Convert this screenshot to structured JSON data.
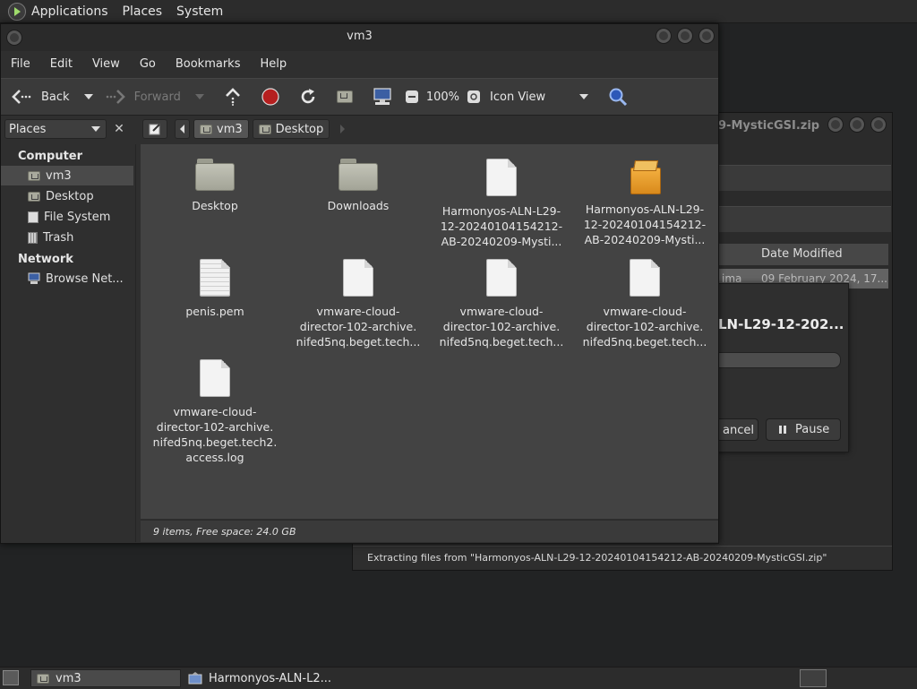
{
  "top_panel": {
    "applications": "Applications",
    "places": "Places",
    "system": "System"
  },
  "background_window": {
    "title": "9-MysticGSI.zip",
    "column_date": "Date Modified",
    "row_name_fragment": "ima",
    "row_date": "09 February 2024, 17...",
    "status": "Extracting files from \"Harmonyos-ALN-L29-12-20240104154212-AB-20240209-MysticGSI.zip\""
  },
  "progress_dialog": {
    "filename": "LN-L29-12-202...",
    "cancel": "ancel",
    "pause": "Pause"
  },
  "file_manager": {
    "title": "vm3",
    "menu": [
      "File",
      "Edit",
      "View",
      "Go",
      "Bookmarks",
      "Help"
    ],
    "toolbar": {
      "back": "Back",
      "forward": "Forward",
      "zoom": "100%",
      "view_mode": "Icon View"
    },
    "sidebar": {
      "selector": "Places",
      "computer_heading": "Computer",
      "network_heading": "Network",
      "items": [
        "vm3",
        "Desktop",
        "File System",
        "Trash"
      ],
      "network_items": [
        "Browse Net..."
      ]
    },
    "path": [
      "vm3",
      "Desktop"
    ],
    "files": [
      {
        "type": "folder",
        "lines": [
          "Desktop"
        ]
      },
      {
        "type": "folder",
        "lines": [
          "Downloads"
        ]
      },
      {
        "type": "doc",
        "lines": [
          "Harmonyos-ALN-L29-",
          "12-20240104154212-",
          "AB-20240209-Mysti..."
        ]
      },
      {
        "type": "archive",
        "lines": [
          "Harmonyos-ALN-L29-",
          "12-20240104154212-",
          "AB-20240209-Mysti..."
        ]
      },
      {
        "type": "lined",
        "lines": [
          "penis.pem"
        ]
      },
      {
        "type": "doc",
        "lines": [
          "vmware-cloud-",
          "director-102-archive.",
          "nifed5nq.beget.tech..."
        ]
      },
      {
        "type": "doc",
        "lines": [
          "vmware-cloud-",
          "director-102-archive.",
          "nifed5nq.beget.tech..."
        ]
      },
      {
        "type": "doc",
        "lines": [
          "vmware-cloud-",
          "director-102-archive.",
          "nifed5nq.beget.tech..."
        ]
      },
      {
        "type": "doc",
        "lines": [
          "vmware-cloud-",
          "director-102-archive.",
          "nifed5nq.beget.tech2.",
          "access.log"
        ]
      }
    ],
    "status": "9 items, Free space: 24.0 GB"
  },
  "taskbar": {
    "tasks": [
      "vm3",
      "Harmonyos-ALN-L2..."
    ]
  }
}
